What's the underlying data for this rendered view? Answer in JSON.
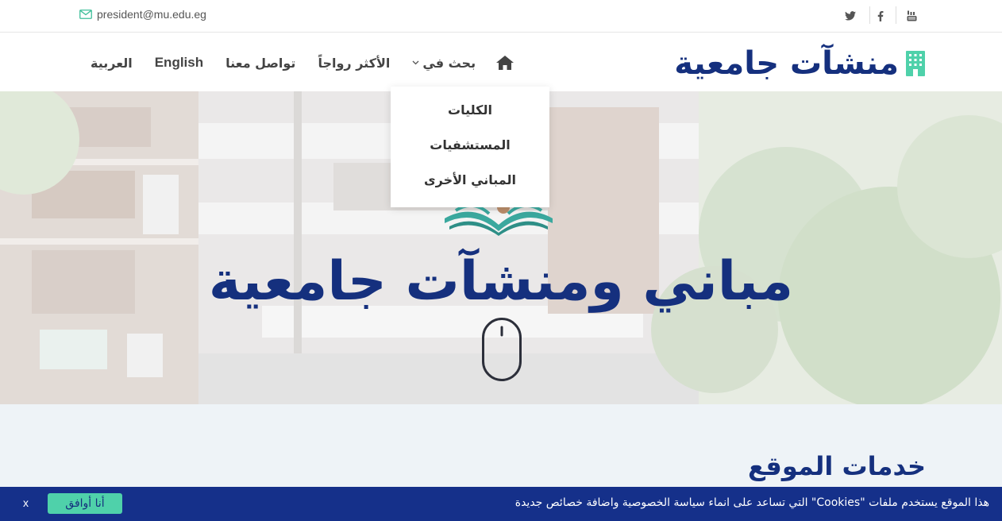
{
  "topbar": {
    "email": "president@mu.edu.eg",
    "social": [
      "twitter-icon",
      "facebook-icon",
      "youtube-icon"
    ]
  },
  "brand": {
    "title": "منشآت جامعية",
    "icon": "building-icon"
  },
  "nav": {
    "home_icon": "home-icon",
    "search_in": "بحث في",
    "most_popular": "الأكثر رواجاً",
    "contact": "تواصل معنا",
    "english": "English",
    "arabic": "العربية"
  },
  "dropdown": {
    "items": [
      "الكليات",
      "المستشفيات",
      "المباني الأخرى"
    ]
  },
  "hero": {
    "title": "مباني ومنشآت جامعية"
  },
  "services": {
    "title": "خدمات الموقع"
  },
  "cookie": {
    "text": "هذا الموقع يستخدم ملفات \"Cookies\" التي تساعد على انماء سياسة الخصوصية واضافة خصائص جديدة",
    "accept": "أنا أوافق",
    "close": "x"
  },
  "colors": {
    "brand": "#15307e",
    "cookie_bg": "#15308a",
    "accent": "#4fd1aa"
  }
}
